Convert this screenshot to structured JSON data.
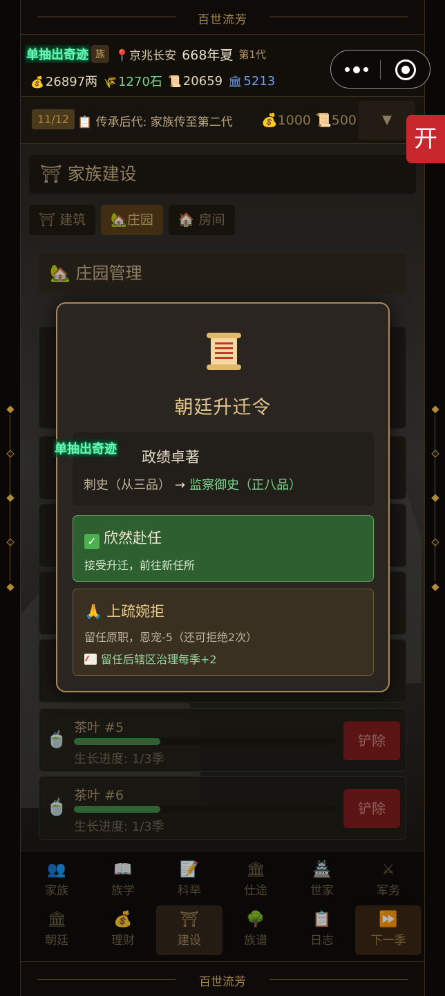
{
  "app": {
    "banner_title": "百世流芳"
  },
  "status": {
    "promo_text": "单抽出奇迹",
    "clan_tag": "族",
    "location": "京兆长安",
    "year": "668年夏",
    "generation": "第1代",
    "money": "26897两",
    "grain": "1270石",
    "scrolls": "20659",
    "buildings": "5213"
  },
  "task": {
    "count": "11/12",
    "description": "传承后代: 家族传至第二代",
    "reward_money": "1000",
    "reward_scroll": "500",
    "dropdown_symbol": "▼"
  },
  "side_tab": {
    "label": "开"
  },
  "section": {
    "title": "家族建设",
    "tabs": [
      {
        "label": "建筑",
        "icon": "torii-icon"
      },
      {
        "label": "庄园",
        "icon": "house-icon"
      },
      {
        "label": "房间",
        "icon": "house-icon"
      }
    ],
    "sub_title": "庄园管理"
  },
  "plots": [
    {
      "name": "茶叶 #5",
      "progress_text": "生长进度: 1/3季",
      "progress": 0.33,
      "action": "铲除"
    },
    {
      "name": "茶叶 #6",
      "progress_text": "生长进度: 1/3季",
      "progress": 0.33,
      "action": "铲除"
    }
  ],
  "modal": {
    "title": "朝廷升迁令",
    "reason": "政绩卓著",
    "from_rank": "刺史（从三品）",
    "arrow": "→",
    "to_rank": "监察御史（正八品）",
    "accept_title": "欣然赴任",
    "accept_desc": "接受升迁，前往新任所",
    "decline_title": "上疏婉拒",
    "decline_desc": "留任原职，恩宠-5（还可拒绝2次）",
    "decline_bonus": "留任后辖区治理每季+2"
  },
  "nav": {
    "row1": [
      {
        "label": "家族",
        "icon": "family-icon"
      },
      {
        "label": "族学",
        "icon": "book-icon"
      },
      {
        "label": "科举",
        "icon": "exam-icon"
      },
      {
        "label": "仕途",
        "icon": "court-icon"
      },
      {
        "label": "世家",
        "icon": "castle-icon"
      },
      {
        "label": "军务",
        "icon": "swords-icon"
      }
    ],
    "row2": [
      {
        "label": "朝廷",
        "icon": "palace-icon"
      },
      {
        "label": "理财",
        "icon": "money-bag-icon"
      },
      {
        "label": "建设",
        "icon": "torii-icon"
      },
      {
        "label": "族谱",
        "icon": "tree-icon"
      },
      {
        "label": "日志",
        "icon": "clipboard-icon"
      },
      {
        "label": "下一季",
        "icon": "fast-forward-icon"
      }
    ]
  },
  "colors": {
    "accent_gold": "#a8874a",
    "danger_red": "#c8282d",
    "accept_green": "#2e5f31"
  }
}
